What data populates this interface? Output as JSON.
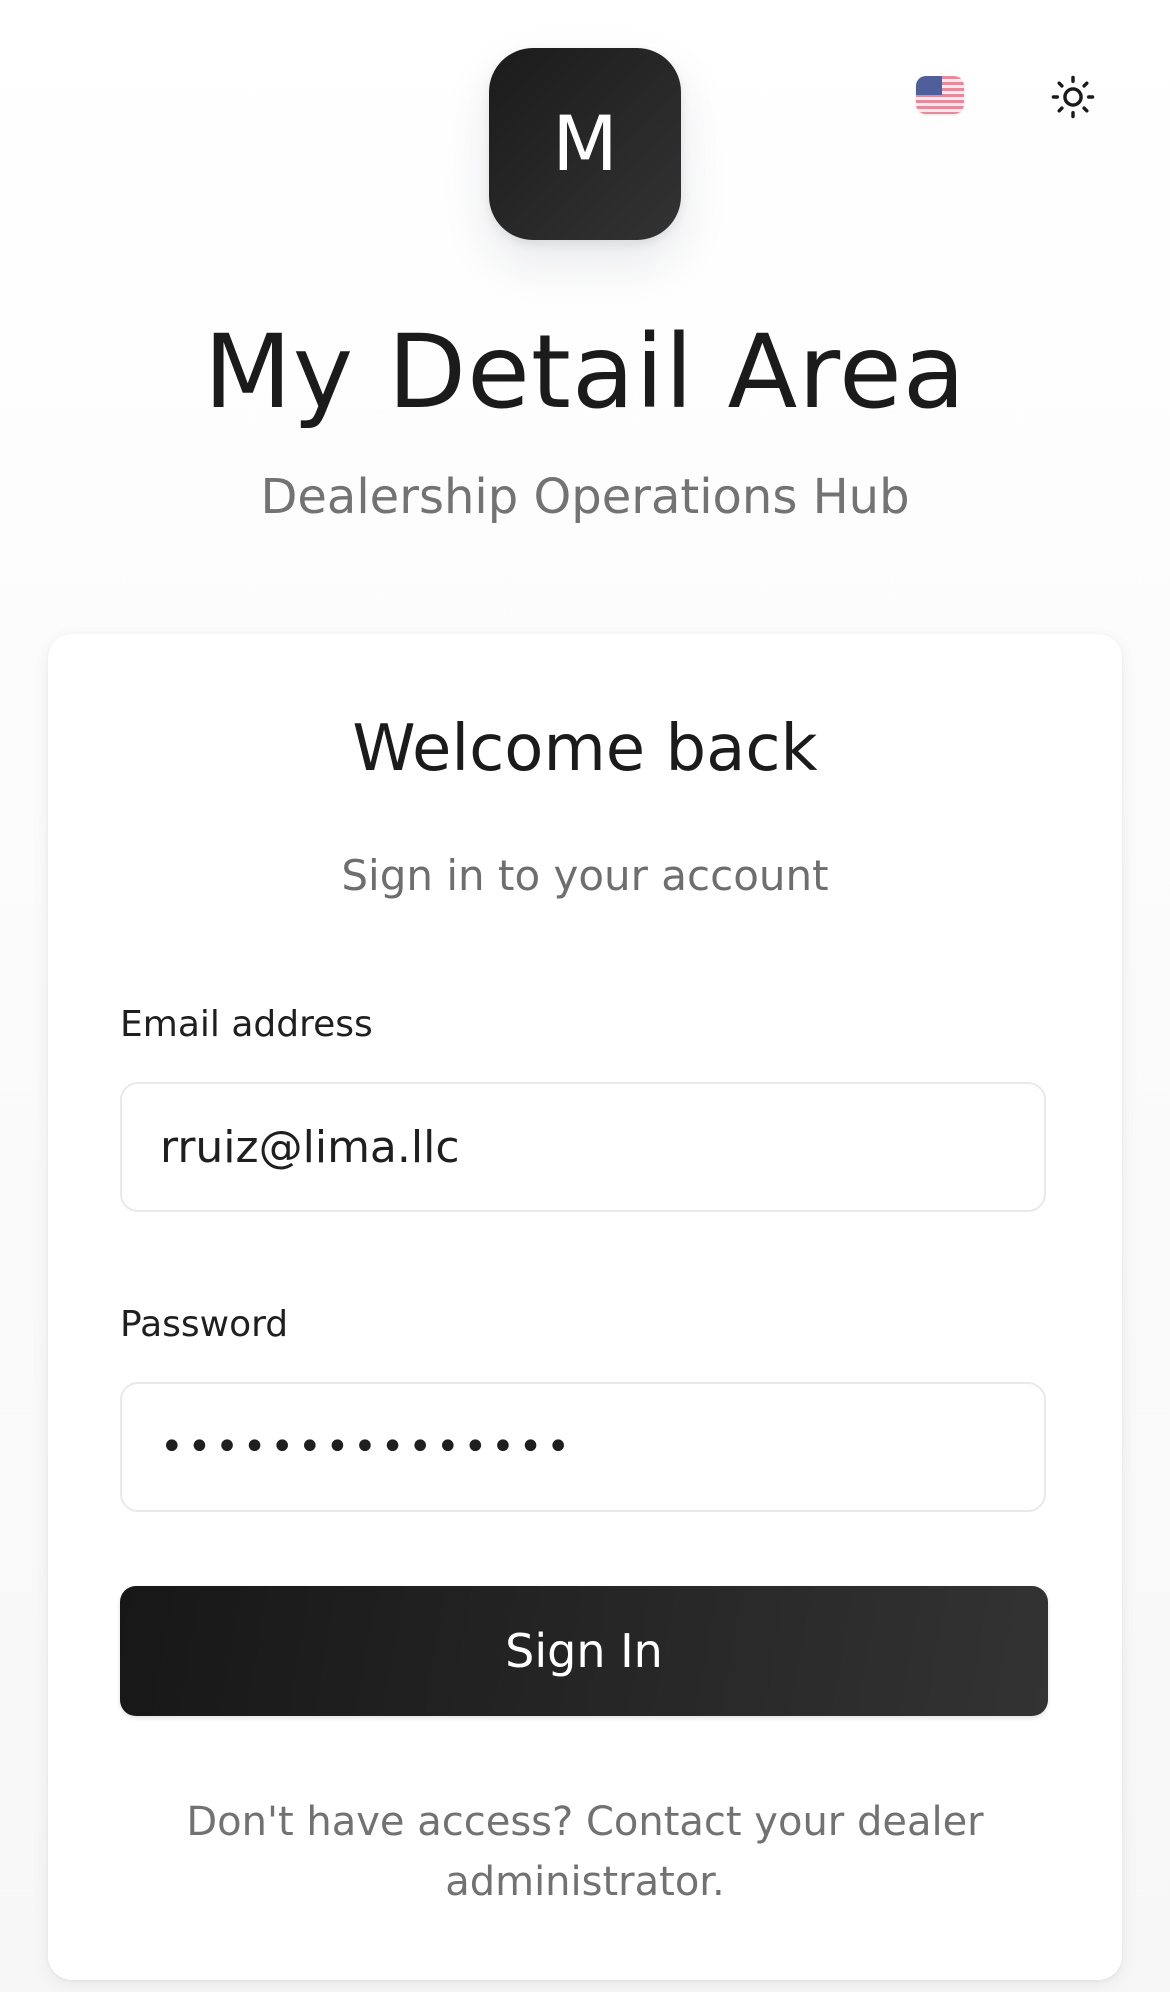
{
  "header": {
    "language_icon": "us-flag-icon",
    "theme_icon": "sun-icon"
  },
  "branding": {
    "logo_letter": "M",
    "app_title": "My Detail Area",
    "app_subtitle": "Dealership Operations Hub"
  },
  "login_card": {
    "title": "Welcome back",
    "subtitle": "Sign in to your account",
    "email": {
      "label": "Email address",
      "value": "rruiz@lima.llc"
    },
    "password": {
      "label": "Password",
      "value": "•••••••••••••••"
    },
    "submit_label": "Sign In",
    "help_text": "Don't have access? Contact your dealer administrator."
  },
  "colors": {
    "primary_button": "#1f1f1f",
    "muted_text": "#737373",
    "background": "#f7f7f7"
  }
}
